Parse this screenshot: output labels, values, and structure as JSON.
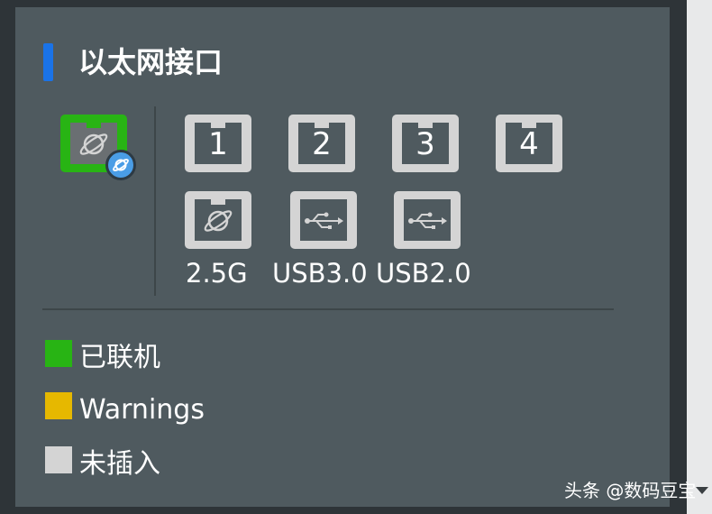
{
  "panel": {
    "title": "以太网接口",
    "accent_color": "#1a73e8"
  },
  "ports": {
    "wan": {
      "icon": "globe-icon",
      "status": "connected",
      "badge_icon": "globe-icon"
    },
    "lan": [
      {
        "label": "1",
        "status": "unplugged"
      },
      {
        "label": "2",
        "status": "unplugged"
      },
      {
        "label": "3",
        "status": "unplugged"
      },
      {
        "label": "4",
        "status": "unplugged"
      }
    ],
    "second_row": [
      {
        "icon": "globe-icon",
        "label": "2.5G",
        "status": "unplugged"
      },
      {
        "icon": "usb-icon",
        "label": "USB3.0",
        "status": "unplugged"
      },
      {
        "icon": "usb-icon",
        "label": "USB2.0",
        "status": "unplugged"
      }
    ]
  },
  "legend": [
    {
      "color": "#28b414",
      "label": "已联机"
    },
    {
      "color": "#e6b800",
      "label": "Warnings"
    },
    {
      "color": "#d4d4d4",
      "label": "未插入"
    }
  ],
  "watermark": "头条 @数码豆宝"
}
